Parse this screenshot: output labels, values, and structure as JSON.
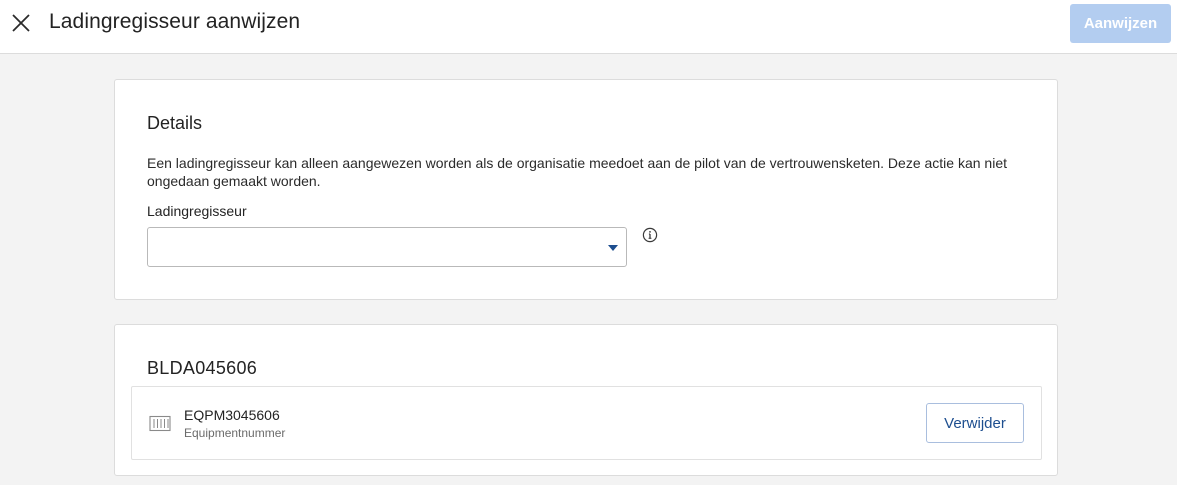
{
  "header": {
    "close_icon": "close-icon",
    "title": "Ladingregisseur aanwijzen",
    "primary_button": "Aanwijzen",
    "primary_button_color": "#b3cdf0"
  },
  "details": {
    "title": "Details",
    "description": "Een ladingregisseur kan alleen aangewezen worden als de organisatie meedoet aan de pilot van de vertrouwensketen. Deze actie kan niet ongedaan gemaakt worden.",
    "field_label": "Ladingregisseur",
    "field_value": "",
    "info_icon": "info-icon"
  },
  "equipment_group": {
    "title": "BLDA045606",
    "items": [
      {
        "icon": "container-icon",
        "number": "EQPM3045606",
        "sublabel": "Equipmentnummer",
        "remove_label": "Verwijder"
      }
    ]
  },
  "colors": {
    "accent": "#1d4e8f",
    "background": "#f3f3f3"
  }
}
